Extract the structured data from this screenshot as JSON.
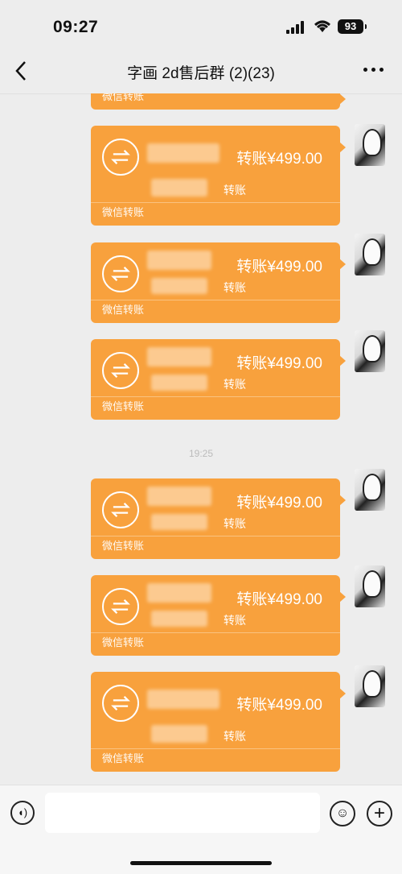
{
  "status_bar": {
    "time": "09:27",
    "battery": "93"
  },
  "nav": {
    "title": "字画 2d售后群 (2)(23)"
  },
  "chat": {
    "top_partial_footer": "微信转账",
    "timestamp": "19:25",
    "messages": [
      {
        "amount": "转账¥499.00",
        "subtitle": "转账",
        "footer": "微信转账"
      },
      {
        "amount": "转账¥499.00",
        "subtitle": "转账",
        "footer": "微信转账"
      },
      {
        "amount": "转账¥499.00",
        "subtitle": "转账",
        "footer": "微信转账"
      },
      {
        "amount": "转账¥499.00",
        "subtitle": "转账",
        "footer": "微信转账"
      },
      {
        "amount": "转账¥499.00",
        "subtitle": "转账",
        "footer": "微信转账"
      },
      {
        "amount": "转账¥499.00",
        "subtitle": "转账",
        "footer": "微信转账"
      }
    ]
  },
  "input_bar": {
    "placeholder": ""
  },
  "icons": {
    "back": "chevron-left-icon",
    "more": "more-dots-icon",
    "voice": "voice-icon",
    "emoji": "emoji-icon",
    "plus": "plus-icon",
    "transfer": "transfer-icon"
  },
  "colors": {
    "transfer_card": "#f8a13d",
    "background": "#ededed"
  }
}
